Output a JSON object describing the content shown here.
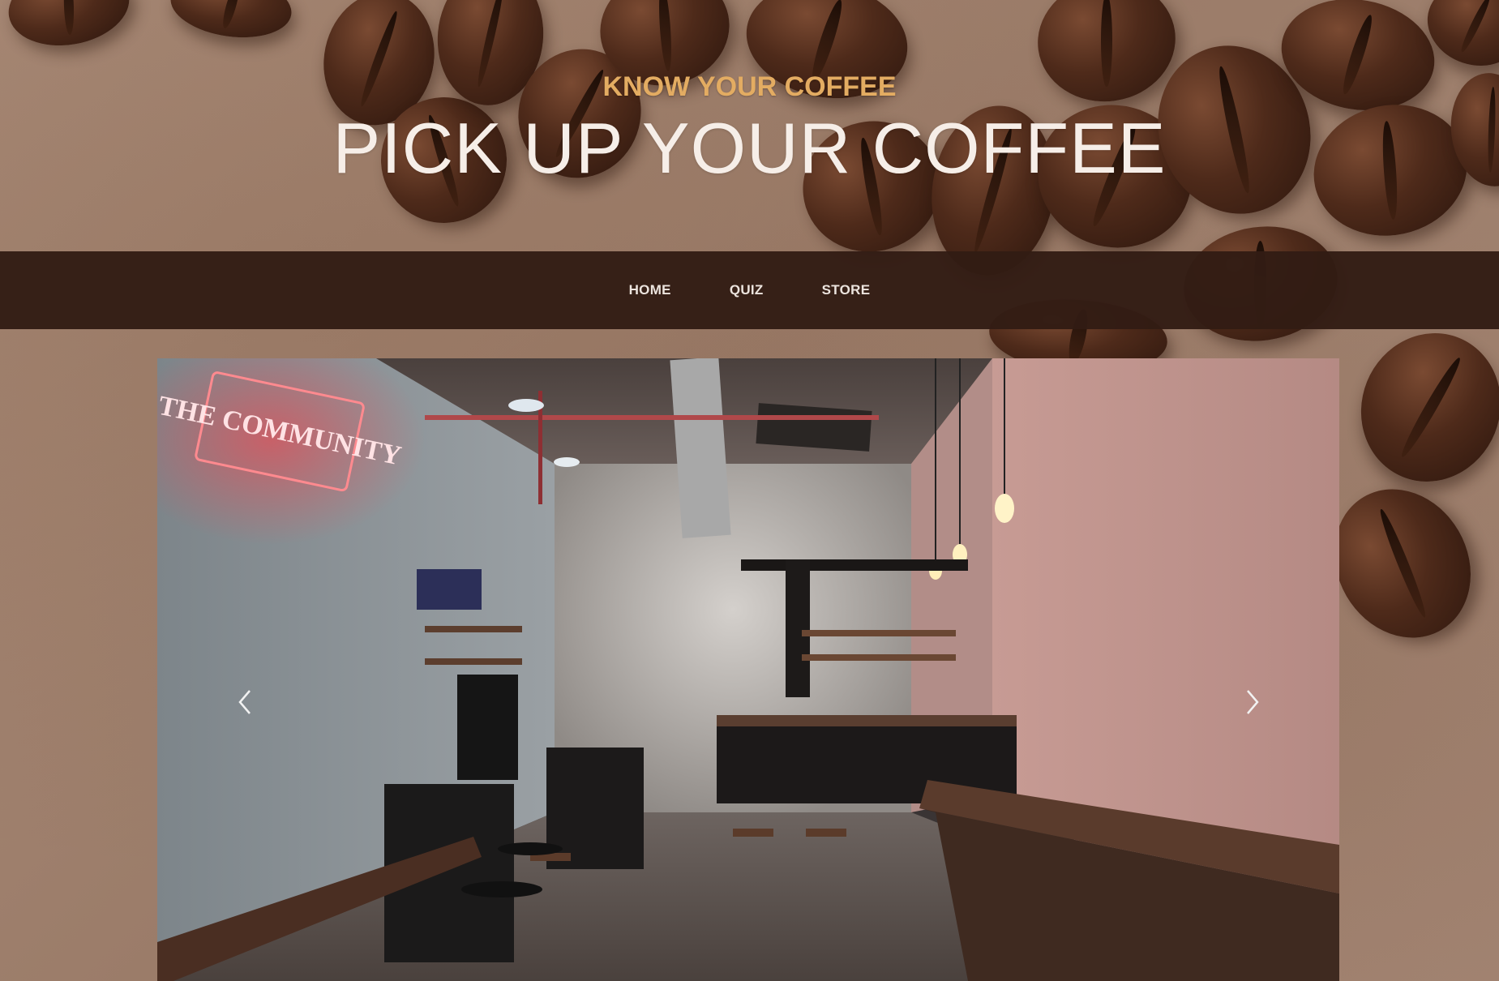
{
  "header": {
    "kicker": "KNOW YOUR COFFEE",
    "headline": "PICK UP YOUR COFFEE"
  },
  "nav": {
    "items": [
      {
        "label": "HOME"
      },
      {
        "label": "QUIZ"
      },
      {
        "label": "STORE"
      }
    ]
  },
  "carousel": {
    "prev_icon": "chevron-left-icon",
    "next_icon": "chevron-right-icon",
    "slide_image": "cafe-interior-photo",
    "neon_sign": "THE COMMUNITY"
  },
  "colors": {
    "kicker": "#e3ac62",
    "headline": "#f6eee8",
    "nav_background": "#321c14",
    "nav_text": "#ece4de"
  }
}
